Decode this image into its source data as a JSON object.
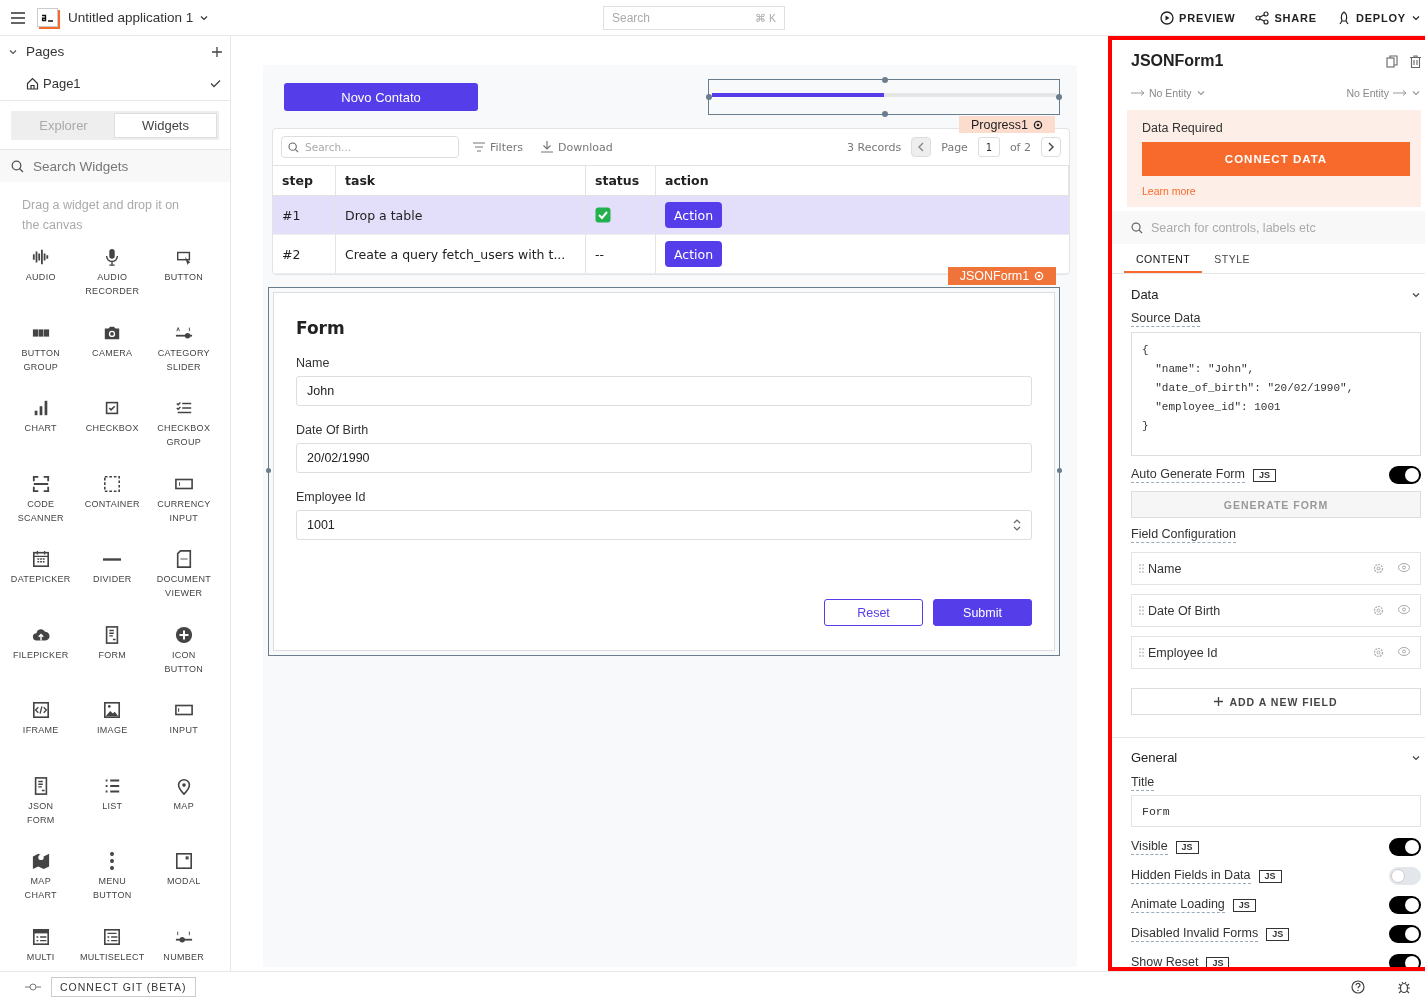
{
  "topbar": {
    "app_name": "Untitled application 1",
    "search": {
      "placeholder": "Search",
      "shortcut": "⌘ K"
    },
    "actions": [
      "PREVIEW",
      "SHARE",
      "DEPLOY"
    ]
  },
  "sidebar": {
    "pages_title": "Pages",
    "pages": [
      {
        "name": "Page1",
        "selected": true
      }
    ],
    "tabs": [
      {
        "label": "Explorer",
        "selected": false
      },
      {
        "label": "Widgets",
        "selected": true
      }
    ],
    "search": {
      "placeholder": "Search Widgets"
    },
    "hint": "Drag a widget and drop it on the canvas",
    "widgets": [
      "AUDIO",
      "AUDIO RECORDER",
      "BUTTON",
      "BUTTON GROUP",
      "CAMERA",
      "CATEGORY SLIDER",
      "CHART",
      "CHECKBOX",
      "CHECKBOX GROUP",
      "CODE SCANNER",
      "CONTAINER",
      "CURRENCY INPUT",
      "DATEPICKER",
      "DIVIDER",
      "DOCUMENT VIEWER",
      "FILEPICKER",
      "FORM",
      "ICON BUTTON",
      "IFRAME",
      "IMAGE",
      "INPUT",
      "JSON FORM",
      "LIST",
      "MAP",
      "MAP CHART",
      "MENU BUTTON",
      "MODAL",
      "MULTI",
      "MULTISELECT",
      "NUMBER"
    ]
  },
  "canvas": {
    "button": "Novo Contato",
    "progress": {
      "level": 0.5,
      "tag": "Progress1"
    },
    "table": {
      "search": {
        "placeholder": "Search..."
      },
      "filters": "Filters",
      "download": "Download",
      "records": "3 Records",
      "page_label": "Page",
      "page": "1",
      "page_total": "of 2",
      "columns": [
        "step",
        "task",
        "status",
        "action"
      ],
      "rows": [
        {
          "step": "#1",
          "task": "Drop a table",
          "status": {
            "kind": "check"
          },
          "action": "Action",
          "selected": true
        },
        {
          "step": "#2",
          "task": "Create a query fetch_users with t...",
          "status": {
            "kind": "text",
            "text": "--"
          },
          "action": "Action",
          "selected": false
        }
      ]
    },
    "form_tag": "JSONForm1",
    "form": {
      "title": "Form",
      "fields": [
        {
          "label": "Name",
          "value": "John",
          "kind": "text"
        },
        {
          "label": "Date Of Birth",
          "value": "20/02/1990",
          "kind": "text"
        },
        {
          "label": "Employee Id",
          "value": "1001",
          "kind": "number"
        }
      ],
      "buttons": [
        "Reset",
        "Submit"
      ]
    }
  },
  "properties": {
    "title": "JSONForm1",
    "entity_in": "No Entity",
    "entity_out": "No Entity",
    "data_required": {
      "title": "Data Required",
      "button": "CONNECT DATA",
      "link": "Learn more"
    },
    "search": {
      "placeholder": "Search for controls, labels etc"
    },
    "tabs": [
      {
        "label": "CONTENT",
        "selected": true
      },
      {
        "label": "STYLE",
        "selected": false
      }
    ],
    "data_section": {
      "title": "Data",
      "source_label": "Source Data",
      "source": "{\n  \"name\": \"John\",\n  \"date_of_birth\": \"20/02/1990\",\n  \"employee_id\": 1001\n}",
      "auto_generate": {
        "label": "Auto Generate Form",
        "badge": "JS",
        "on": true
      },
      "generate_button": "GENERATE FORM",
      "field_config_label": "Field Configuration",
      "fields": [
        "Name",
        "Date Of Birth",
        "Employee Id"
      ],
      "add_field": "ADD A NEW FIELD"
    },
    "general_section": {
      "title": "General",
      "title_label": "Title",
      "title_value": "Form",
      "toggles": [
        {
          "label": "Visible",
          "badge": "JS",
          "on": true
        },
        {
          "label": "Hidden Fields in Data",
          "badge": "JS",
          "on": false
        },
        {
          "label": "Animate Loading",
          "badge": "JS",
          "on": true
        },
        {
          "label": "Disabled Invalid Forms",
          "badge": "JS",
          "on": true
        },
        {
          "label": "Show Reset",
          "badge": "JS",
          "on": true
        }
      ]
    }
  },
  "footer": {
    "git_button": "CONNECT GIT (BETA)"
  }
}
